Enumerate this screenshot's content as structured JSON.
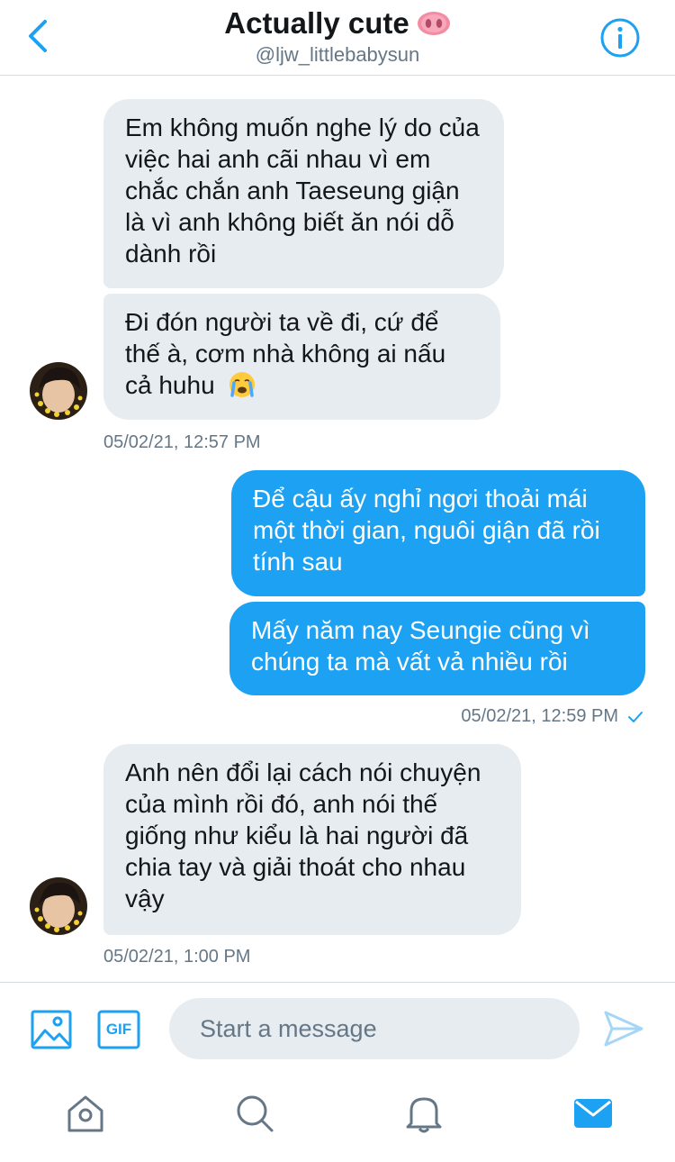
{
  "header": {
    "title": "Actually cute",
    "title_emoji": "pig-nose-emoji",
    "handle": "@ljw_littlebabysun",
    "back_icon": "chevron-left-icon",
    "info_icon": "info-icon"
  },
  "messages": {
    "m1": "Em không muốn nghe lý do của việc hai anh cãi nhau vì em chắc chắn anh Taeseung giận là vì anh không biết ăn nói dỗ dành rồi",
    "m2": "Đi đón người ta về đi, cứ để thế à, cơm nhà không ai nấu cả huhu",
    "m2_emoji": "crying-face-emoji",
    "ts1": "05/02/21, 12:57 PM",
    "m3": "Để cậu ấy nghỉ ngơi thoải mái một thời gian, nguôi giận đã rồi tính sau",
    "m4": "Mấy năm nay Seungie cũng vì chúng ta mà vất vả nhiều rồi",
    "ts2": "05/02/21, 12:59 PM",
    "m5": "Anh nên đổi lại cách nói chuyện của mình rồi đó, anh nói thế giống như kiểu là hai người đã chia tay và giải thoát cho nhau vậy",
    "ts3": "05/02/21, 1:00 PM"
  },
  "composer": {
    "placeholder": "Start a message",
    "gif_label": "GIF",
    "icons": [
      "image-icon",
      "gif-icon",
      "send-icon"
    ]
  },
  "tabs": [
    "home-icon",
    "search-icon",
    "notifications-icon",
    "messages-icon"
  ],
  "colors": {
    "accent": "#1da1f2",
    "received_bubble": "#e6ecf0",
    "muted_text": "#657786",
    "divider": "#d8dde2"
  }
}
